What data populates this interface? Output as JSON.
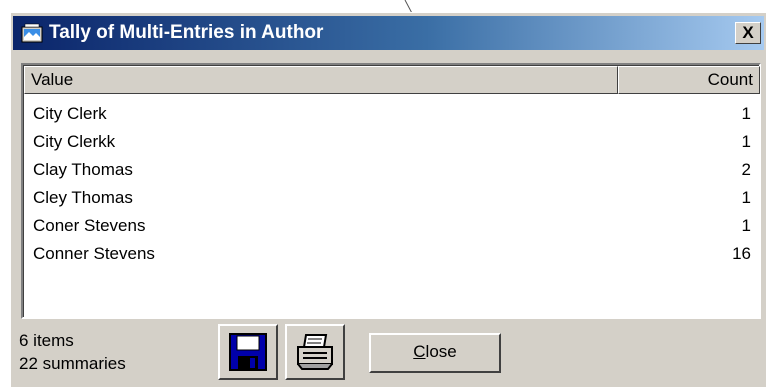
{
  "window": {
    "title": "Tally of Multi-Entries in Author",
    "close_glyph": "X"
  },
  "list": {
    "columns": [
      "Value",
      "Count"
    ],
    "rows": [
      {
        "value": "City Clerk",
        "count": "1"
      },
      {
        "value": "City Clerkk",
        "count": "1"
      },
      {
        "value": "Clay Thomas",
        "count": "2"
      },
      {
        "value": "Cley Thomas",
        "count": "1"
      },
      {
        "value": "Coner Stevens",
        "count": "1"
      },
      {
        "value": "Conner Stevens",
        "count": "16"
      }
    ]
  },
  "status": {
    "items": "6 items",
    "summaries": "22 summaries"
  },
  "buttons": {
    "close_label": "Close",
    "save_icon": "floppy-disk-icon",
    "print_icon": "printer-icon"
  },
  "colors": {
    "titlebar_start": "#0a246a",
    "titlebar_end": "#a6caf0",
    "face": "#d4d0c8",
    "floppy": "#0000aa"
  }
}
